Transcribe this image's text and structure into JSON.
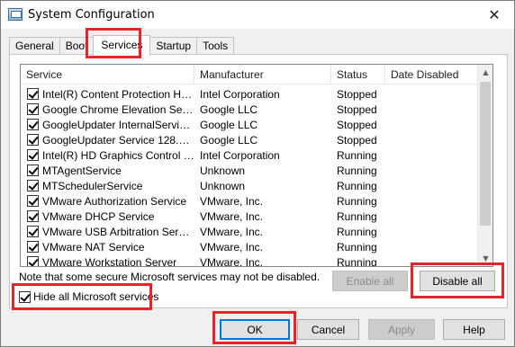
{
  "window": {
    "title": "System Configuration",
    "close_glyph": "✕"
  },
  "tabs": [
    {
      "label": "General",
      "active": false
    },
    {
      "label": "Boot",
      "active": false
    },
    {
      "label": "Services",
      "active": true
    },
    {
      "label": "Startup",
      "active": false
    },
    {
      "label": "Tools",
      "active": false
    }
  ],
  "services_table": {
    "columns": [
      "Service",
      "Manufacturer",
      "Status",
      "Date Disabled"
    ],
    "rows": [
      {
        "checked": true,
        "service": "Intel(R) Content Protection HEC...",
        "manufacturer": "Intel Corporation",
        "status": "Stopped",
        "date_disabled": ""
      },
      {
        "checked": true,
        "service": "Google Chrome Elevation Servic...",
        "manufacturer": "Google LLC",
        "status": "Stopped",
        "date_disabled": ""
      },
      {
        "checked": true,
        "service": "GoogleUpdater InternalService ...",
        "manufacturer": "Google LLC",
        "status": "Stopped",
        "date_disabled": ""
      },
      {
        "checked": true,
        "service": "GoogleUpdater Service 128.0.6...",
        "manufacturer": "Google LLC",
        "status": "Stopped",
        "date_disabled": ""
      },
      {
        "checked": true,
        "service": "Intel(R) HD Graphics Control Pa...",
        "manufacturer": "Intel Corporation",
        "status": "Running",
        "date_disabled": ""
      },
      {
        "checked": true,
        "service": "MTAgentService",
        "manufacturer": "Unknown",
        "status": "Running",
        "date_disabled": ""
      },
      {
        "checked": true,
        "service": "MTSchedulerService",
        "manufacturer": "Unknown",
        "status": "Running",
        "date_disabled": ""
      },
      {
        "checked": true,
        "service": "VMware Authorization Service",
        "manufacturer": "VMware, Inc.",
        "status": "Running",
        "date_disabled": ""
      },
      {
        "checked": true,
        "service": "VMware DHCP Service",
        "manufacturer": "VMware, Inc.",
        "status": "Running",
        "date_disabled": ""
      },
      {
        "checked": true,
        "service": "VMware USB Arbitration Service",
        "manufacturer": "VMware, Inc.",
        "status": "Running",
        "date_disabled": ""
      },
      {
        "checked": true,
        "service": "VMware NAT Service",
        "manufacturer": "VMware, Inc.",
        "status": "Running",
        "date_disabled": ""
      },
      {
        "checked": true,
        "service": "VMware Workstation Server",
        "manufacturer": "VMware, Inc.",
        "status": "Running",
        "date_disabled": ""
      }
    ]
  },
  "note": "Note that some secure Microsoft services may not be disabled.",
  "buttons": {
    "enable_all": "Enable all",
    "disable_all": "Disable all",
    "ok": "OK",
    "cancel": "Cancel",
    "apply": "Apply",
    "help": "Help"
  },
  "hide_ms_services": {
    "label": "Hide all Microsoft services",
    "checked": true
  },
  "icons": {
    "scroll_up": "▲",
    "scroll_down": "▼"
  },
  "colors": {
    "highlight": "#e8232a",
    "default_button_border": "#0078d7"
  }
}
